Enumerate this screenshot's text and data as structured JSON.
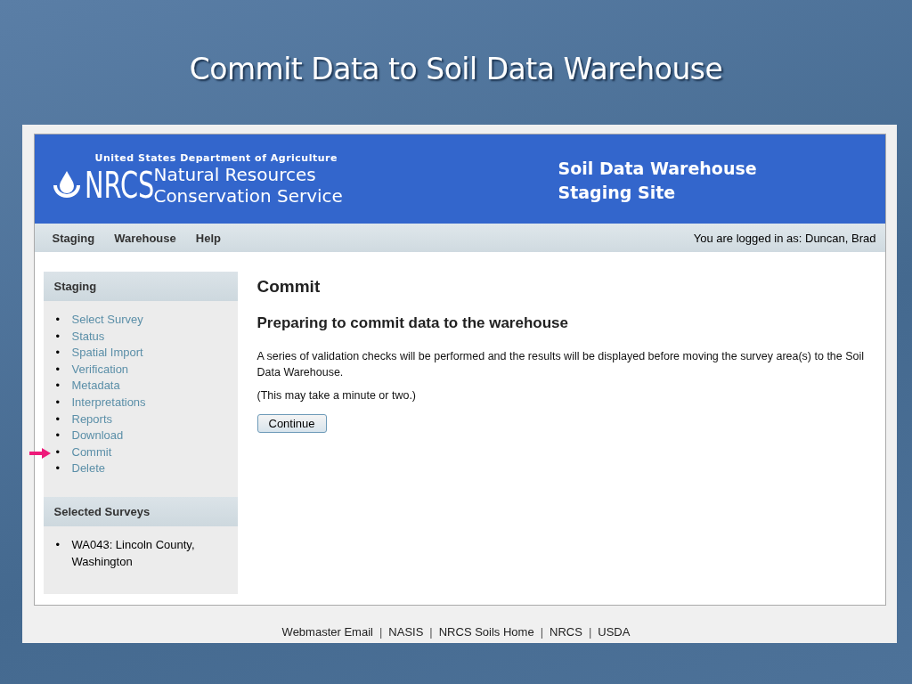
{
  "slide": {
    "title": "Commit Data to Soil Data Warehouse"
  },
  "header": {
    "agency": "United States Department of Agriculture",
    "logo_text": "NRCS",
    "agency_name": [
      "Natural Resources",
      "Conservation Service"
    ],
    "site_title": [
      "Soil Data Warehouse",
      "Staging Site"
    ]
  },
  "nav": {
    "items": [
      "Staging",
      "Warehouse",
      "Help"
    ],
    "user": "You are logged in as: Duncan, Brad"
  },
  "sidebar": {
    "sections": [
      {
        "title": "Staging",
        "kind": "links",
        "marker": "•",
        "items": [
          {
            "label": "Select Survey",
            "pointed": false
          },
          {
            "label": "Status",
            "pointed": false
          },
          {
            "label": "Spatial Import",
            "pointed": false
          },
          {
            "label": "Verification",
            "pointed": false
          },
          {
            "label": "Metadata",
            "pointed": false
          },
          {
            "label": "Interpretations",
            "pointed": false
          },
          {
            "label": "Reports",
            "pointed": false
          },
          {
            "label": "Download",
            "pointed": false
          },
          {
            "label": "Commit",
            "pointed": true
          },
          {
            "label": "Delete",
            "pointed": false
          }
        ]
      },
      {
        "title": "Selected Surveys",
        "kind": "text",
        "marker": "•",
        "items": [
          {
            "label": "WA043: Lincoln County, Washington",
            "pointed": false
          }
        ]
      }
    ]
  },
  "main": {
    "title": "Commit",
    "subtitle": "Preparing to commit data to the warehouse",
    "paragraphs": [
      "A series of validation checks will be performed and the results will be displayed before moving the survey area(s) to the Soil Data Warehouse.",
      "(This may take a minute or two.)"
    ],
    "button": "Continue"
  },
  "footer": {
    "items": [
      {
        "kind": "link",
        "text": "Webmaster Email"
      },
      {
        "kind": "separator",
        "text": "|"
      },
      {
        "kind": "link",
        "text": "NASIS"
      },
      {
        "kind": "separator",
        "text": "|"
      },
      {
        "kind": "link",
        "text": "NRCS Soils Home"
      },
      {
        "kind": "separator",
        "text": "|"
      },
      {
        "kind": "link",
        "text": "NRCS"
      },
      {
        "kind": "separator",
        "text": "|"
      },
      {
        "kind": "link",
        "text": "USDA"
      }
    ]
  }
}
